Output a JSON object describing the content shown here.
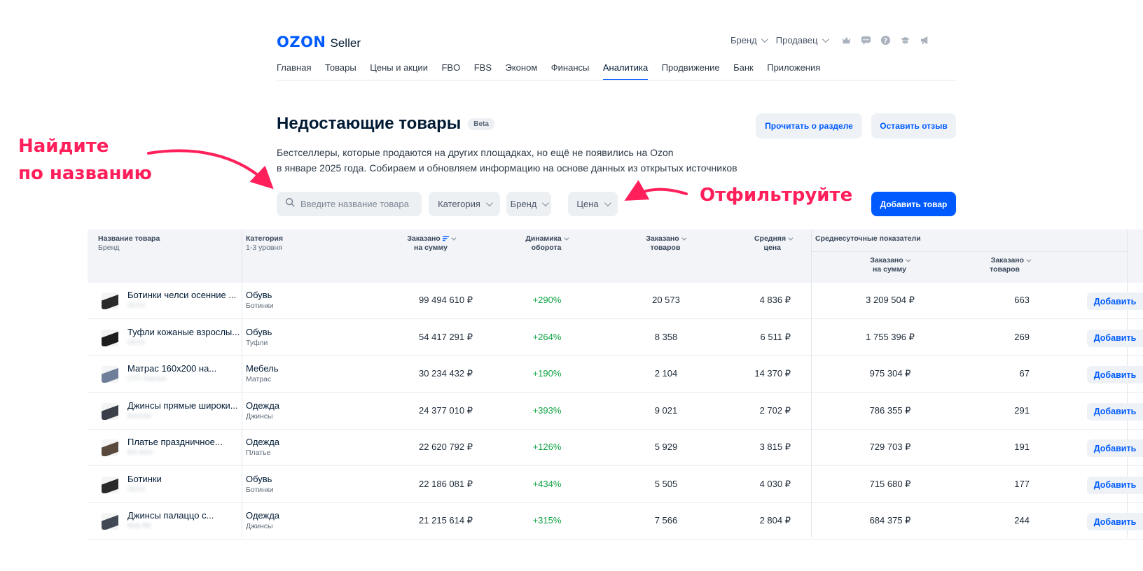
{
  "header": {
    "logo_main": "OZON",
    "logo_sub": "Seller",
    "dropdowns": [
      "Бренд",
      "Продавец"
    ],
    "icons": [
      "crown-icon",
      "chat-icon",
      "help-icon",
      "graduation-cap-icon",
      "megaphone-icon"
    ]
  },
  "nav": {
    "items": [
      "Главная",
      "Товары",
      "Цены и акции",
      "FBO",
      "FBS",
      "Эконом",
      "Финансы",
      "Аналитика",
      "Продвижение",
      "Банк",
      "Приложения"
    ],
    "active": "Аналитика"
  },
  "page": {
    "title": "Недостающие товары",
    "badge": "Beta",
    "description_line1": "Бестселлеры, которые продаются на других площадках, но ещё не появились на Ozon",
    "description_line2": "в январе 2025 года. Собираем и обновляем информацию на основе данных из открытых источников",
    "read_button": "Прочитать о разделе",
    "review_button": "Оставить отзыв",
    "add_product_button": "Добавить товар"
  },
  "filters": {
    "search_placeholder": "Введите название товара",
    "category": "Категория",
    "brand": "Бренд",
    "price": "Цена"
  },
  "annotations": {
    "find_line1": "Найдите",
    "find_line2": "по названию",
    "filter": "Отфильтруйте"
  },
  "table": {
    "headers": {
      "name": "Название товара",
      "name_sub": "Бренд",
      "category": "Категория",
      "category_sub": "1-3 уровня",
      "ordered_sum_1": "Заказано",
      "ordered_sum_2": "на сумму",
      "dynamics_1": "Динамика",
      "dynamics_2": "оборота",
      "ordered_qty_1": "Заказано",
      "ordered_qty_2": "товаров",
      "avg_price_1": "Средняя",
      "avg_price_2": "цена",
      "daily_group": "Среднесуточные показатели",
      "daily_sum_1": "Заказано",
      "daily_sum_2": "на сумму",
      "daily_qty_1": "Заказано",
      "daily_qty_2": "товаров"
    },
    "add_label": "Добавить",
    "rows": [
      {
        "name": "Ботинки челси осенние ...",
        "brand": "DEOX",
        "category": "Обувь",
        "subcategory": "Ботинки",
        "ordered_sum": "99 494 610 ₽",
        "dynamics": "+290%",
        "ordered_qty": "20 573",
        "avg_price": "4 836 ₽",
        "daily_sum": "3 209 504 ₽",
        "daily_qty": "663"
      },
      {
        "name": "Туфли кожаные взрослы...",
        "brand": "DEOX",
        "category": "Обувь",
        "subcategory": "Туфли",
        "ordered_sum": "54 417 291 ₽",
        "dynamics": "+264%",
        "ordered_qty": "8 358",
        "avg_price": "6 511 ₽",
        "daily_sum": "1 755 396 ₽",
        "daily_qty": "269"
      },
      {
        "name": "Матрас 160х200 на...",
        "brand": "CITY Matrasa",
        "category": "Мебель",
        "subcategory": "Матрас",
        "ordered_sum": "30 234 432 ₽",
        "dynamics": "+190%",
        "ordered_qty": "2 104",
        "avg_price": "14 370 ₽",
        "daily_sum": "975 304 ₽",
        "daily_qty": "67"
      },
      {
        "name": "Джинсы прямые широки...",
        "brand": "Baranda",
        "category": "Одежда",
        "subcategory": "Джинсы",
        "ordered_sum": "24 377 010 ₽",
        "dynamics": "+393%",
        "ordered_qty": "9 021",
        "avg_price": "2 702 ₽",
        "daily_sum": "786 355 ₽",
        "daily_qty": "291"
      },
      {
        "name": "Платье праздничное...",
        "brand": "Brit store",
        "category": "Одежда",
        "subcategory": "Платье",
        "ordered_sum": "22 620 792 ₽",
        "dynamics": "+126%",
        "ordered_qty": "5 929",
        "avg_price": "3 815 ₽",
        "daily_sum": "729 703 ₽",
        "daily_qty": "191"
      },
      {
        "name": "Ботинки",
        "brand": "DEOX",
        "category": "Обувь",
        "subcategory": "Ботинки",
        "ordered_sum": "22 186 081 ₽",
        "dynamics": "+434%",
        "ordered_qty": "5 505",
        "avg_price": "4 030 ₽",
        "daily_sum": "715 680 ₽",
        "daily_qty": "177"
      },
      {
        "name": "Джинсы палаццо с...",
        "brand": "Mely BB",
        "category": "Одежда",
        "subcategory": "Джинсы",
        "ordered_sum": "21 215 614 ₽",
        "dynamics": "+315%",
        "ordered_qty": "7 566",
        "avg_price": "2 804 ₽",
        "daily_sum": "684 375 ₽",
        "daily_qty": "244"
      }
    ],
    "thumb_colors": [
      "#2a2a2a",
      "#1e1e1e",
      "#6f7f9a",
      "#3a3f4a",
      "#5a4a3e",
      "#2b2b2b",
      "#414955"
    ]
  },
  "colors": {
    "brand": "#005bff",
    "accent_annotation": "#ff1f5a",
    "positive": "#10a345"
  }
}
